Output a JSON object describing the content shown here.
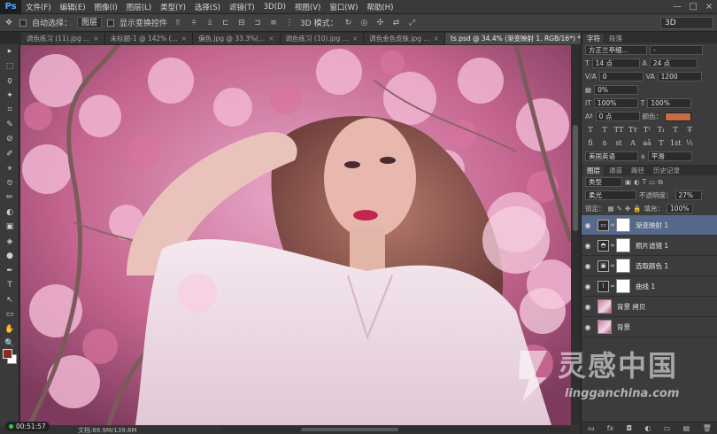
{
  "app": {
    "logo": "Ps"
  },
  "menu": [
    "文件(F)",
    "编辑(E)",
    "图像(I)",
    "图层(L)",
    "类型(Y)",
    "选择(S)",
    "滤镜(T)",
    "3D(D)",
    "视图(V)",
    "窗口(W)",
    "帮助(H)"
  ],
  "window_controls": [
    "—",
    "□",
    "×"
  ],
  "options": {
    "auto_select_label": "自动选择：",
    "auto_select_value": "图层",
    "show_transform_label": "显示变换控件",
    "mode_3d_label": "3D 模式：",
    "workspace": "3D"
  },
  "tabs": [
    {
      "label": "调色练习 (11).jpg ...",
      "active": false
    },
    {
      "label": "未标题-1 @ 142% (...",
      "active": false
    },
    {
      "label": "偏色.jpg @ 33.3%(...",
      "active": false
    },
    {
      "label": "调色练习 (10).jpg ...",
      "active": false
    },
    {
      "label": "调色金色皮肤.jpg ...",
      "active": false
    },
    {
      "label": "ts.psd @ 34.4% (渐变映射 1, RGB/16*) *",
      "active": true
    }
  ],
  "tools": [
    "▸",
    "⬚",
    "ϙ",
    "✦",
    "⌗",
    "✎",
    "⊘",
    "✐",
    "⚹",
    "⎊",
    "✏",
    "◐",
    "▣",
    "◈",
    "●",
    "✒",
    "T",
    "↖",
    "▭",
    "✋",
    "🔍"
  ],
  "status": {
    "time": "00:51:57",
    "doc_info": "文档:69.9M/139.8M"
  },
  "character_panel": {
    "tabs": [
      "字符",
      "段落"
    ],
    "font_family": "方正兰亭细...",
    "font_style": "-",
    "size": "14 点",
    "leading": "24 点",
    "kerning": "0",
    "tracking": "1200",
    "scale_pct": "0%",
    "vscale": "100%",
    "hscale": "100%",
    "baseline": "0 点",
    "color_label": "颜色：",
    "text_color": "#c66b45",
    "typo_buttons": [
      "T",
      "T",
      "TT",
      "Tт",
      "T¹",
      "T₁",
      "T",
      "T̶"
    ],
    "ot_buttons": [
      "fi",
      "ꝺ",
      "st",
      "A",
      "aā",
      "T",
      "1st",
      "½"
    ],
    "language": "美国英语",
    "aa": "a",
    "aa_method": "平滑"
  },
  "layers_panel": {
    "tabs": [
      "图层",
      "通道",
      "路径",
      "历史记录"
    ],
    "filter_kind": "类型",
    "blend_mode": "柔光",
    "opacity_label": "不透明度：",
    "opacity": "27%",
    "lock_label": "锁定：",
    "fill_label": "填充：",
    "fill": "100%",
    "layers": [
      {
        "name": "渐变映射 1",
        "icon": "▭",
        "type": "adjustment",
        "active": true
      },
      {
        "name": "照片滤镜 1",
        "icon": "◓",
        "type": "adjustment",
        "active": false
      },
      {
        "name": "选取颜色 1",
        "icon": "▣",
        "type": "adjustment",
        "active": false
      },
      {
        "name": "曲线 1",
        "icon": "⌇",
        "type": "adjustment",
        "active": false
      },
      {
        "name": "背景 拷贝",
        "icon": "",
        "type": "image",
        "active": false
      },
      {
        "name": "背景",
        "icon": "",
        "type": "image",
        "active": false
      }
    ],
    "bottom_icons": [
      "ᔓ",
      "fx",
      "◘",
      "◐",
      "▭",
      "▤",
      "🗑"
    ]
  },
  "watermark": {
    "text": "灵感中国",
    "url": "lingganchina.com"
  }
}
